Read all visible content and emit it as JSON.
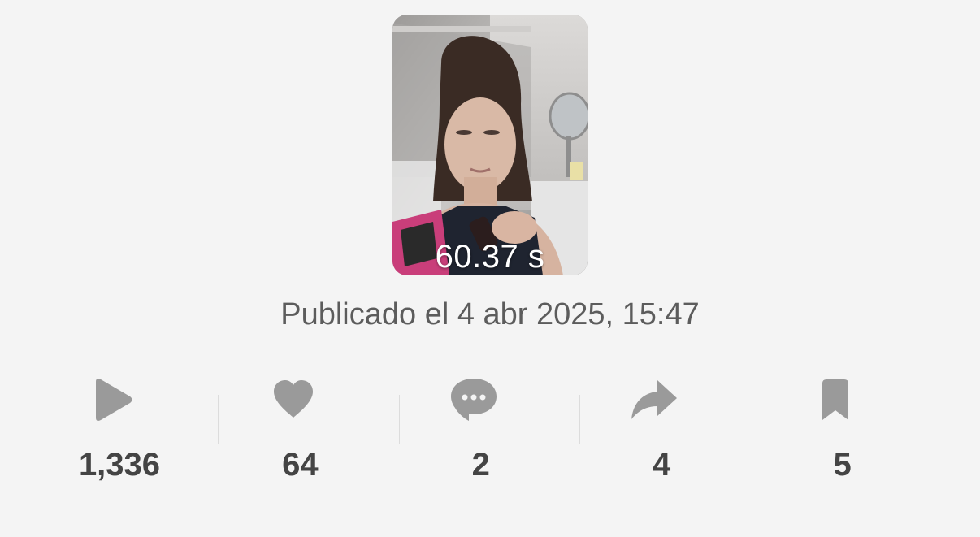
{
  "video": {
    "duration_label": "60.37 s",
    "thumbnail_icon": "video-thumbnail"
  },
  "published_label": "Publicado el 4 abr 2025, 15:47",
  "colors": {
    "background": "#f4f4f4",
    "icon": "#9a9a9a",
    "value_text": "#444444",
    "secondary_text": "#5c5c5c"
  },
  "stats": [
    {
      "icon": "play-icon",
      "value": "1,336"
    },
    {
      "icon": "heart-icon",
      "value": "64"
    },
    {
      "icon": "comment-icon",
      "value": "2"
    },
    {
      "icon": "share-icon",
      "value": "4"
    },
    {
      "icon": "bookmark-icon",
      "value": "5"
    }
  ]
}
